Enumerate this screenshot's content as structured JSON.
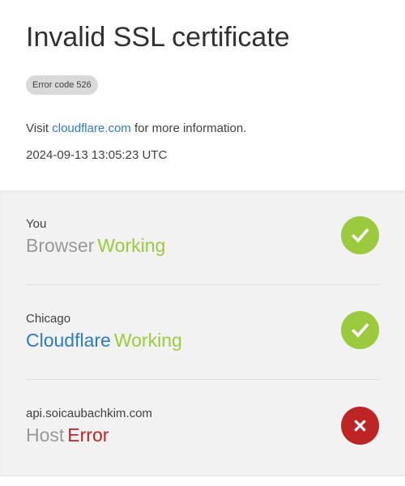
{
  "header": {
    "title": "Invalid SSL certificate",
    "error_badge": "Error code 526",
    "visit_prefix": "Visit ",
    "visit_link": "cloudflare.com",
    "visit_suffix": " for more information.",
    "timestamp": "2024-09-13 13:05:23 UTC"
  },
  "status_rows": [
    {
      "location": "You",
      "name": "Browser",
      "status": "Working",
      "state": "ok",
      "icon": "checkmark-icon",
      "status_color": "#9bca3e"
    },
    {
      "location": "Chicago",
      "name": "Cloudflare",
      "status": "Working",
      "state": "ok",
      "icon": "checkmark-icon",
      "status_color": "#9bca3e"
    },
    {
      "location": "api.soicaubachkim.com",
      "name": "Host",
      "status": "Error",
      "state": "error",
      "icon": "x-icon",
      "status_color": "#bd2426"
    }
  ],
  "colors": {
    "link_blue": "#2f7bbf",
    "working_green": "#9bca3e",
    "error_red": "#bd2426",
    "badge_gray": "#d9d9d9",
    "status_bg": "#f2f2f2"
  }
}
